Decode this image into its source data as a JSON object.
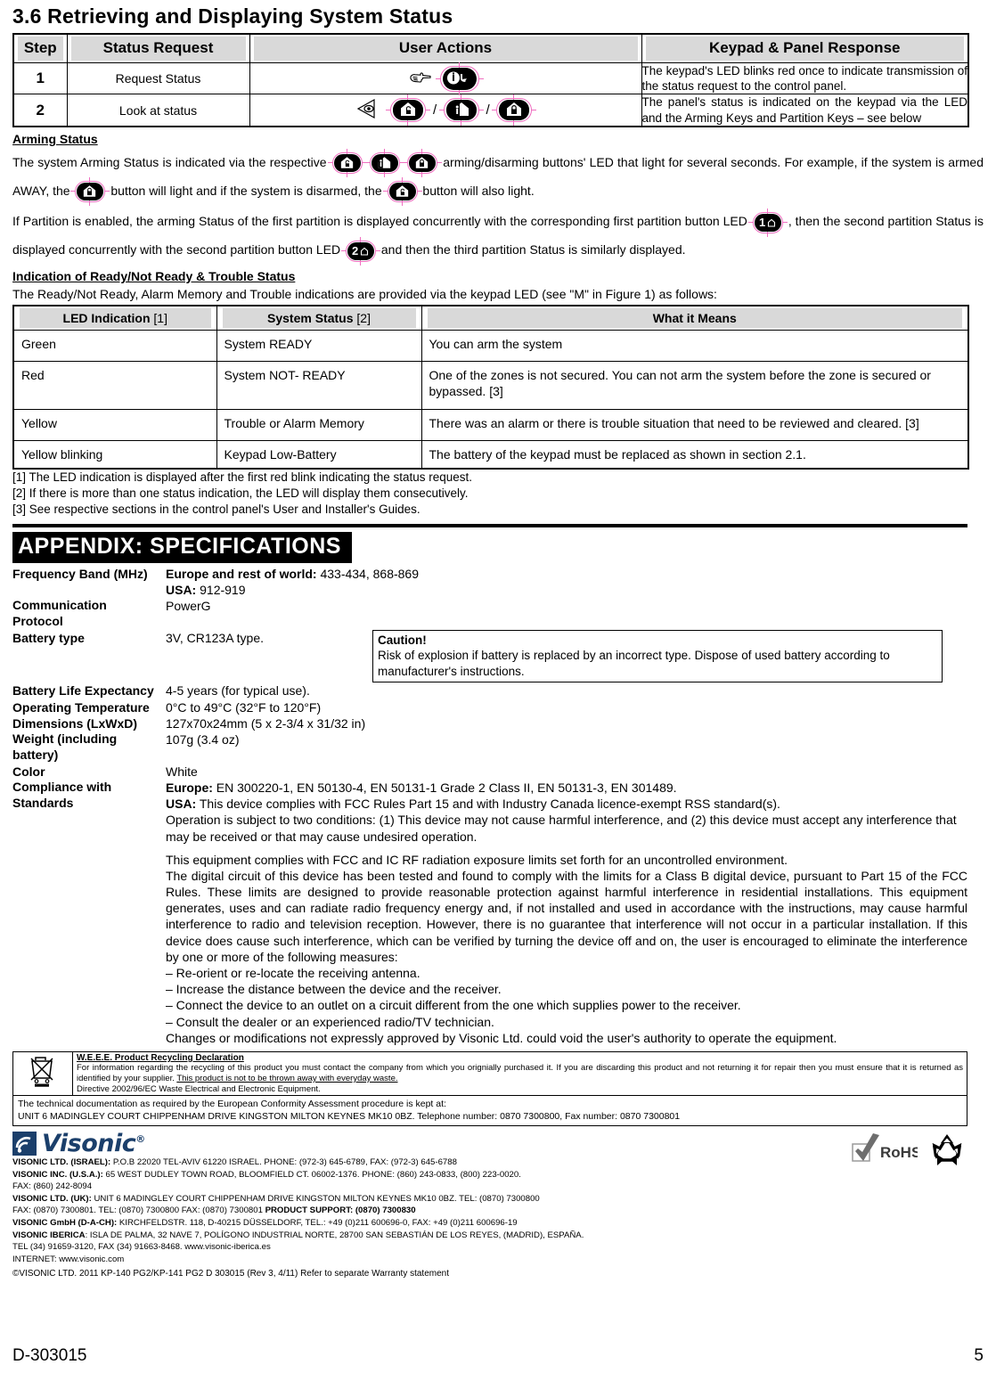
{
  "section": {
    "heading": "3.6 Retrieving and Displaying System Status"
  },
  "steps_table": {
    "headers": [
      "Step",
      "Status Request",
      "User Actions",
      "Keypad & Panel Response"
    ],
    "rows": [
      {
        "step": "1",
        "request": "Request Status",
        "action_icons": [
          "hand-pointer-icon",
          "status-request-key-icon"
        ],
        "response": "The keypad's LED blinks red once to indicate transmission of the status request to the control panel."
      },
      {
        "step": "2",
        "request": "Look at status",
        "action_icons": [
          "eye-look-icon",
          "disarm-key-icon",
          "home-arm-key-icon",
          "away-arm-key-icon"
        ],
        "response": "The panel's status is indicated on the keypad via the LED and the Arming Keys and Partition Keys – see below"
      }
    ]
  },
  "arming_status": {
    "heading": "Arming Status",
    "para1_a": "The system Arming Status is indicated via the respective",
    "para1_b": "arming/disarming buttons' LED that light for several seconds. For example, if the system is armed AWAY, the",
    "para1_c": "button will light and if the system is disarmed, the",
    "para1_d": "button will also light.",
    "para2_a": "If Partition is enabled, the arming Status of the first partition is displayed concurrently with the corresponding first partition button LED",
    "para2_b": ", then the second partition Status is displayed concurrently with the second partition button LED",
    "para2_c": "and then the third partition Status is similarly displayed.",
    "partition1_label": "1",
    "partition2_label": "2"
  },
  "led_section": {
    "heading": "Indication of Ready/Not Ready & Trouble Status",
    "intro": "The Ready/Not Ready, Alarm Memory and Trouble indications are provided via the keypad LED (see \"M\" in Figure 1) as follows:",
    "headers": [
      {
        "bold": "LED Indication",
        "ref": " [1]"
      },
      {
        "bold": "System Status",
        "ref": " [2]"
      },
      {
        "bold": "What it Means",
        "ref": ""
      }
    ],
    "rows": [
      {
        "indication": "Green",
        "status": "System READY",
        "means": "You can arm the system"
      },
      {
        "indication": "Red",
        "status": "System NOT- READY",
        "means": "One of the zones is not secured. You can not arm the system before the zone is secured or bypassed. [3]"
      },
      {
        "indication": "Yellow",
        "status": "Trouble or Alarm Memory",
        "means": "There was an alarm or there is trouble situation that need to be reviewed and cleared. [3]"
      },
      {
        "indication": "Yellow blinking",
        "status": "Keypad Low-Battery",
        "means": "The battery of the keypad must be replaced as shown in section 2.1."
      }
    ],
    "footnotes": [
      "[1] The LED indication is displayed after the first red blink indicating the status request.",
      "[2] If there is more than one status indication, the LED will display them consecutively.",
      "[3] See respective sections in the control panel's User and Installer's Guides."
    ]
  },
  "appendix": {
    "title": "APPENDIX: SPECIFICATIONS",
    "rows": [
      {
        "label": "Frequency Band (MHz)",
        "value_bold_1": "Europe and rest of world:",
        "value_1": " 433-434, 868-869",
        "value_bold_2": "USA:",
        "value_2": " 912-919"
      },
      {
        "label": "Communication Protocol",
        "value": "PowerG"
      },
      {
        "label": "Battery type",
        "value": "3V, CR123A type."
      },
      {
        "label": "Battery Life Expectancy",
        "value": "4-5 years (for typical use)."
      },
      {
        "label": "Operating Temperature",
        "value": "0°C to 49°C (32°F to 120°F)"
      },
      {
        "label": "Dimensions (LxWxD)",
        "value": "127x70x24mm (5 x 2-3/4 x 31/32 in)"
      },
      {
        "label": "Weight (including battery)",
        "value": "107g (3.4 oz)"
      },
      {
        "label": "Color",
        "value": "White"
      }
    ],
    "caution": {
      "title": "Caution!",
      "text": "Risk of explosion if battery is replaced by an incorrect type. Dispose of used battery according to manufacturer's instructions."
    },
    "compliance": {
      "label": "Compliance with Standards",
      "europe_bold": "Europe:",
      "europe": " EN 300220-1, EN 50130-4, EN 50131-1 Grade 2 Class II, EN 50131-3, EN 301489.",
      "usa_bold": "USA:",
      "usa": " This device complies with FCC Rules Part 15 and with Industry Canada licence-exempt RSS standard(s).",
      "para_conditions": "Operation is subject to two conditions: (1) This device may not cause harmful interference, and (2) this device must accept any interference that may be received or that may cause undesired operation.",
      "para_rf": "This equipment complies with FCC and IC RF radiation exposure limits set forth for an uncontrolled environment.",
      "para_classb": "The digital circuit of this device has been tested and found to comply with the limits for a Class B digital device, pursuant to Part 15 of the FCC Rules. These limits are designed to provide reasonable protection against harmful interference in residential installations. This equipment generates, uses and can radiate radio frequency energy and, if not installed and used in accordance with the instructions, may cause harmful interference to radio and television reception. However, there is no guarantee that interference will not occur in a particular installation. If this device does cause such interference, which can be verified by turning the device off and on, the user is encouraged to eliminate the interference by one or more of the following measures:",
      "measures": [
        "– Re-orient or re-locate the receiving antenna.",
        "– Increase the distance between the device and the receiver.",
        "– Connect the device to an outlet on a circuit different from the one which supplies power to the receiver.",
        "– Consult the dealer or an experienced radio/TV technician."
      ],
      "para_changes": "Changes or modifications not expressly approved by Visonic Ltd. could void the user's authority to operate the equipment."
    }
  },
  "weee": {
    "icon": "crossed-out-wheelie-bin-icon",
    "title": "W.E.E.E. Product Recycling Declaration",
    "body_1": "For  information regarding the recycling  of this product  you must contact the  company from which you orignially purchased it. If you are discarding this product and not returning it for repair then you must ensure that it is returned as identified by your supplier. ",
    "body_underlined": "This product is not to be thrown away with everyday waste.",
    "body_2": "Directive 2002/96/EC Waste Electrical and Electronic Equipment."
  },
  "tech_doc": {
    "line1": "The technical documentation as required by the European Conformity Assessment procedure is kept at:",
    "line2": "UNIT 6 MADINGLEY COURT CHIPPENHAM DRIVE KINGSTON MILTON KEYNES MK10 0BZ. Telephone number: 0870 7300800, Fax number: 0870 7300801"
  },
  "footer": {
    "logo_text": "Visonic",
    "logo_reg": "®",
    "logo_mark": "wifi-signal-icon",
    "certs": [
      "rohs-check-icon",
      "recycle-icon"
    ],
    "address_lines": [
      {
        "bold": "VISONIC LTD. (ISRAEL):",
        "rest": " P.O.B 22020 TEL-AVIV 61220 ISRAEL. PHONE: (972-3) 645-6789, FAX: (972-3) 645-6788"
      },
      {
        "bold": "VISONIC INC. (U.S.A.):",
        "rest": " 65 WEST DUDLEY TOWN ROAD, BLOOMFIELD CT. 06002-1376. PHONE: (860) 243-0833, (800) 223-0020."
      },
      {
        "bold": "",
        "rest": "FAX: (860) 242-8094"
      },
      {
        "bold": "VISONIC LTD. (UK):",
        "rest": " UNIT 6 MADINGLEY COURT CHIPPENHAM DRIVE KINGSTON MILTON KEYNES MK10 0BZ. TEL: (0870) 7300800"
      },
      {
        "bold": "",
        "rest": "FAX: (0870) 7300801. TEL: (0870) 7300800 FAX: (0870) 7300801 ",
        "bold_tail": "PRODUCT SUPPORT: (0870) 7300830"
      },
      {
        "bold": "VISONIC GmbH (D-A-CH):",
        "rest": " KIRCHFELDSTR. 118, D-40215 DÜSSELDORF, TEL.: +49 (0)211 600696-0, FAX: +49 (0)211 600696-19"
      },
      {
        "bold": "VISONIC IBERICA",
        "rest": ": ISLA DE PALMA, 32 NAVE 7, POLÍGONO INDUSTRIAL NORTE, 28700 SAN SEBASTIÁN DE LOS REYES, (MADRID), ESPAÑA."
      },
      {
        "bold": "",
        "rest": "TEL (34) 91659-3120, FAX (34) 91663-8468. www.visonic-iberica.es"
      },
      {
        "bold": "",
        "rest": "INTERNET: www.visonic.com"
      }
    ],
    "copyright": "©VISONIC LTD. 2011      KP-140 PG2/KP-141 PG2       D 303015 (Rev 3, 4/11)     Refer to separate Warranty statement",
    "doc_id": "D-303015",
    "page_number": "5"
  },
  "colors": {
    "crop_mark": "#f06ec0",
    "header_gray": "#d9d9d9",
    "brand_navy": "#1b3f6b"
  }
}
